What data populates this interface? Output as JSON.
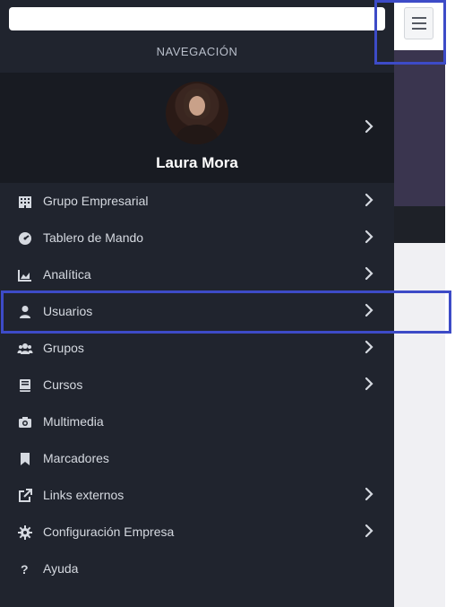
{
  "sidebar": {
    "heading": "NAVEGACIÓN",
    "search": {
      "value": "",
      "placeholder": ""
    },
    "profile": {
      "name": "Laura Mora"
    },
    "items": [
      {
        "label": "Grupo Empresarial",
        "icon": "building-icon",
        "has_submenu": true
      },
      {
        "label": "Tablero de Mando",
        "icon": "dashboard-gauge-icon",
        "has_submenu": true
      },
      {
        "label": "Analítica",
        "icon": "area-chart-icon",
        "has_submenu": true
      },
      {
        "label": "Usuarios",
        "icon": "user-icon",
        "has_submenu": true
      },
      {
        "label": "Grupos",
        "icon": "users-group-icon",
        "has_submenu": true
      },
      {
        "label": "Cursos",
        "icon": "book-icon",
        "has_submenu": true
      },
      {
        "label": "Multimedia",
        "icon": "camera-icon",
        "has_submenu": false
      },
      {
        "label": "Marcadores",
        "icon": "bookmark-icon",
        "has_submenu": false
      },
      {
        "label": "Links externos",
        "icon": "external-link-icon",
        "has_submenu": true
      },
      {
        "label": "Configuración Empresa",
        "icon": "gear-icon",
        "has_submenu": true
      },
      {
        "label": "Ayuda",
        "icon": "question-icon",
        "has_submenu": false
      }
    ]
  },
  "header": {
    "menu_toggle_icon": "hamburger-icon"
  },
  "colors": {
    "sidebar_bg": "#20242e",
    "profile_bg": "#181b22",
    "text": "#d5d9e0",
    "highlight": "#3d4bc7"
  }
}
